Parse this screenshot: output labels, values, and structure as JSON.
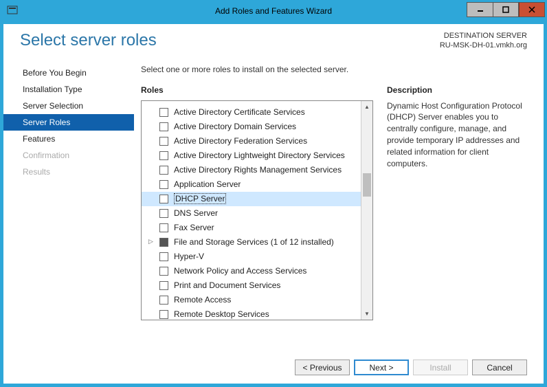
{
  "titlebar": {
    "title": "Add Roles and Features Wizard"
  },
  "header": {
    "heading": "Select server roles",
    "dest_label": "DESTINATION SERVER",
    "dest_server": "RU-MSK-DH-01.vmkh.org"
  },
  "nav": {
    "items": [
      {
        "label": "Before You Begin",
        "state": "normal"
      },
      {
        "label": "Installation Type",
        "state": "normal"
      },
      {
        "label": "Server Selection",
        "state": "normal"
      },
      {
        "label": "Server Roles",
        "state": "selected"
      },
      {
        "label": "Features",
        "state": "normal"
      },
      {
        "label": "Confirmation",
        "state": "disabled"
      },
      {
        "label": "Results",
        "state": "disabled"
      }
    ]
  },
  "content": {
    "instruction": "Select one or more roles to install on the selected server.",
    "roles_label": "Roles",
    "desc_label": "Description",
    "desc_text": "Dynamic Host Configuration Protocol (DHCP) Server enables you to centrally configure, manage, and provide temporary IP addresses and related information for client computers.",
    "roles": [
      {
        "label": "Active Directory Certificate Services"
      },
      {
        "label": "Active Directory Domain Services"
      },
      {
        "label": "Active Directory Federation Services"
      },
      {
        "label": "Active Directory Lightweight Directory Services"
      },
      {
        "label": "Active Directory Rights Management Services"
      },
      {
        "label": "Application Server"
      },
      {
        "label": "DHCP Server",
        "selected": true
      },
      {
        "label": "DNS Server"
      },
      {
        "label": "Fax Server"
      },
      {
        "label": "File and Storage Services (1 of 12 installed)",
        "expander": true,
        "filled": true
      },
      {
        "label": "Hyper-V"
      },
      {
        "label": "Network Policy and Access Services"
      },
      {
        "label": "Print and Document Services"
      },
      {
        "label": "Remote Access"
      },
      {
        "label": "Remote Desktop Services"
      }
    ]
  },
  "footer": {
    "previous": "< Previous",
    "next": "Next >",
    "install": "Install",
    "cancel": "Cancel"
  }
}
